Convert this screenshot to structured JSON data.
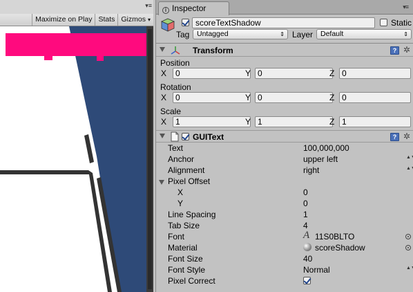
{
  "game_view": {
    "toolbar": {
      "maximize_on_play": "Maximize on Play",
      "stats": "Stats",
      "gizmos": "Gizmos",
      "gizmos_arrow": "▾"
    },
    "tab_menu_glyph": "▾≡",
    "colors": {
      "magenta": "#ff0a7e",
      "navy": "#2e4a78",
      "stripe": "#333333",
      "canvas": "#ffffff"
    }
  },
  "inspector": {
    "tab_label": "Inspector",
    "tab_icon": "i",
    "tab_menu_glyph": "▾≡",
    "gameobject": {
      "active": true,
      "name": "scoreTextShadow",
      "static_checked": false,
      "static_label": "Static",
      "tag_label": "Tag",
      "tag_value": "Untagged",
      "layer_label": "Layer",
      "layer_value": "Default",
      "select_arrow": "⇕"
    },
    "transform": {
      "title": "Transform",
      "help_glyph": "?",
      "gear_glyph": "✲",
      "position_label": "Position",
      "rotation_label": "Rotation",
      "scale_label": "Scale",
      "axis_x": "X",
      "axis_y": "Y",
      "axis_z": "Z",
      "position": {
        "x": "0",
        "y": "0",
        "z": "0"
      },
      "rotation": {
        "x": "0",
        "y": "0",
        "z": "0"
      },
      "scale": {
        "x": "1",
        "y": "1",
        "z": "1"
      }
    },
    "guitext": {
      "title": "GUIText",
      "enabled": true,
      "help_glyph": "?",
      "gear_glyph": "✲",
      "text_label": "Text",
      "text_value": "100,000,000",
      "anchor_label": "Anchor",
      "anchor_value": "upper left",
      "alignment_label": "Alignment",
      "alignment_value": "right",
      "pixel_offset_label": "Pixel Offset",
      "pixel_offset_x_label": "X",
      "pixel_offset_x": "0",
      "pixel_offset_y_label": "Y",
      "pixel_offset_y": "0",
      "line_spacing_label": "Line Spacing",
      "line_spacing_value": "1",
      "tab_size_label": "Tab Size",
      "tab_size_value": "4",
      "font_label": "Font",
      "font_glyph": "A",
      "font_value": "11S0BLTO",
      "material_label": "Material",
      "material_value": "scoreShadow",
      "font_size_label": "Font Size",
      "font_size_value": "40",
      "font_style_label": "Font Style",
      "font_style_value": "Normal",
      "pixel_correct_label": "Pixel Correct",
      "pixel_correct": true,
      "updown_glyph": "▲▼"
    }
  }
}
